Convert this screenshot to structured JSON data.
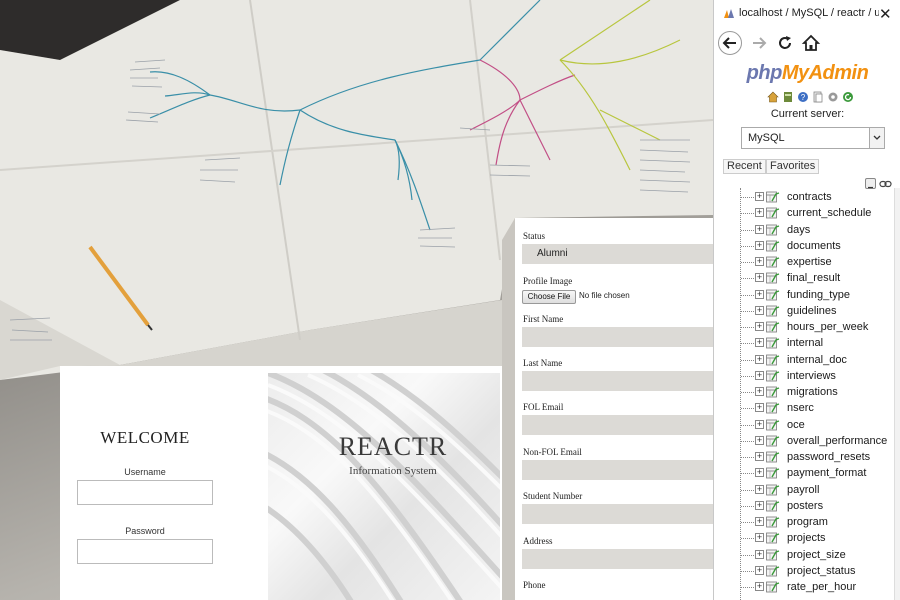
{
  "login": {
    "welcome": "WELCOME",
    "username_label": "Username",
    "password_label": "Password",
    "app_name": "REACTR",
    "app_subtitle": "Information System"
  },
  "profile_form": {
    "status_label": "Status",
    "status_value": "Alumni",
    "profile_image_label": "Profile Image",
    "choose_file_label": "Choose File",
    "no_file_text": "No file chosen",
    "first_name_label": "First Name",
    "last_name_label": "Last Name",
    "fol_email_label": "FOL Email",
    "non_fol_email_label": "Non-FOL Email",
    "student_number_label": "Student Number",
    "address_label": "Address",
    "phone_label": "Phone"
  },
  "browser": {
    "tab_title": "localhost / MySQL / reactr / use",
    "close_glyph": "✕"
  },
  "phpmyadmin": {
    "logo_php": "php",
    "logo_myadmin": "MyAdmin",
    "current_server_label": "Current server:",
    "server_value": "MySQL",
    "recent_tab": "Recent",
    "favorites_tab": "Favorites",
    "tables": [
      "contracts",
      "current_schedule",
      "days",
      "documents",
      "expertise",
      "final_result",
      "funding_type",
      "guidelines",
      "hours_per_week",
      "internal",
      "internal_doc",
      "interviews",
      "migrations",
      "nserc",
      "oce",
      "overall_performance",
      "password_resets",
      "payment_format",
      "payroll",
      "posters",
      "program",
      "projects",
      "project_size",
      "project_status",
      "rate_per_hour"
    ],
    "colors": {
      "php": "#6c78af",
      "myadmin": "#f29111"
    }
  },
  "icons": {
    "toolbar": [
      "home-icon",
      "database-icon",
      "help-icon",
      "docs-icon",
      "settings-icon",
      "reload-icon"
    ],
    "tree_table_icon": "table-icon"
  }
}
